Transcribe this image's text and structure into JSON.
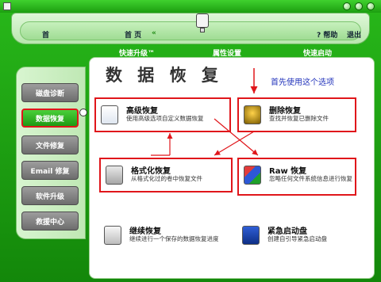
{
  "header": {
    "home_label": "首",
    "home_tab_label": "首 页",
    "help_label": "? 帮助",
    "exit_label": "退出"
  },
  "subnav": {
    "quick_upgrade": "快速升级™",
    "properties": "属性设置",
    "quick_start": "快速启动"
  },
  "sidebar": {
    "items": [
      {
        "label": "磁盘诊断"
      },
      {
        "label": "数据恢复"
      },
      {
        "label": "文件修复"
      },
      {
        "label": "Email 修复"
      },
      {
        "label": "软件升级"
      },
      {
        "label": "救援中心"
      }
    ]
  },
  "main": {
    "title": "数 据 恢 复",
    "note": "首先使用这个选项",
    "cards": [
      {
        "title": "高级恢复",
        "desc": "使用高级选项自定义数据恢复"
      },
      {
        "title": "删除恢复",
        "desc": "查找并恢复已删除文件"
      },
      {
        "title": "格式化恢复",
        "desc": "从格式化过的卷中恢复文件"
      },
      {
        "title": "Raw 恢复",
        "desc": "忽略任何文件系统信息进行恢复"
      },
      {
        "title": "继续恢复",
        "desc": "继续进行一个保存的数据恢复进度"
      },
      {
        "title": "紧急启动盘",
        "desc": "创建自引导紧急启动盘"
      }
    ]
  },
  "icons": [
    "doc-icon",
    "trash-icon",
    "format-icon",
    "raw-icon",
    "resume-icon",
    "floppy-icon"
  ],
  "colors": {
    "accent": "#1f9a13",
    "highlight": "#e0161b",
    "note": "#2233bb"
  }
}
